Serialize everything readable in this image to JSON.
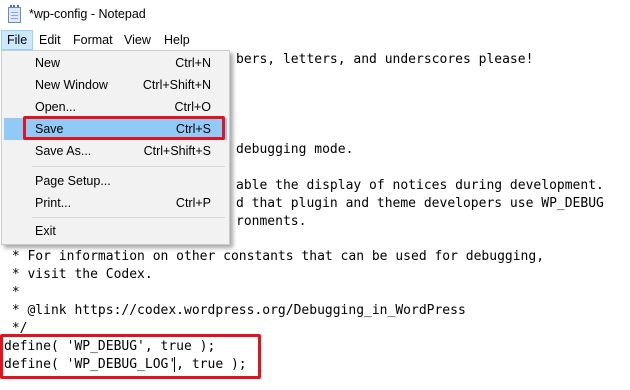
{
  "window": {
    "title": "*wp-config - Notepad"
  },
  "menubar": {
    "file": "File",
    "edit": "Edit",
    "format": "Format",
    "view": "View",
    "help": "Help"
  },
  "file_menu": {
    "new": {
      "label": "New",
      "shortcut": "Ctrl+N"
    },
    "new_window": {
      "label": "New Window",
      "shortcut": "Ctrl+Shift+N"
    },
    "open": {
      "label": "Open...",
      "shortcut": "Ctrl+O"
    },
    "save": {
      "label": "Save",
      "shortcut": "Ctrl+S"
    },
    "save_as": {
      "label": "Save As...",
      "shortcut": "Ctrl+Shift+S"
    },
    "page_setup": {
      "label": "Page Setup...",
      "shortcut": ""
    },
    "print": {
      "label": "Print...",
      "shortcut": "Ctrl+P"
    },
    "exit": {
      "label": "Exit",
      "shortcut": ""
    }
  },
  "editor": {
    "visible_lines": [
      "bers, letters, and underscores please!",
      "debugging mode.",
      "able the display of notices during development.",
      "d that plugin and theme developers use WP_DEBUG",
      "ronments.",
      " * For information on other constants that can be used for debugging,",
      " * visit the Codex.",
      " *",
      " * @link https://codex.wordpress.org/Debugging_in_WordPress",
      " */",
      "define( 'WP_DEBUG', true );",
      "define( 'WP_DEBUG_LOG', true );"
    ]
  },
  "colors": {
    "highlight": "#91c9f7",
    "menu_active": "#cce8ff",
    "annotation_red": "#e1141e"
  }
}
